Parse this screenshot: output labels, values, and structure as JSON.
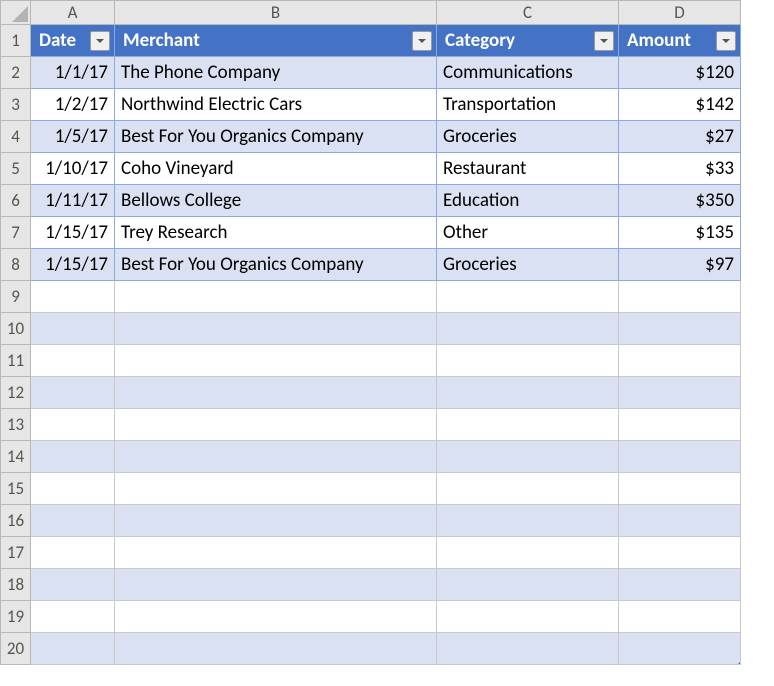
{
  "columns": [
    "A",
    "B",
    "C",
    "D"
  ],
  "row_count": 20,
  "table": {
    "headers": [
      {
        "label": "Date"
      },
      {
        "label": "Merchant"
      },
      {
        "label": "Category"
      },
      {
        "label": "Amount"
      }
    ],
    "rows": [
      {
        "date": "1/1/17",
        "merchant": "The Phone Company",
        "category": "Communications",
        "amount": "$120"
      },
      {
        "date": "1/2/17",
        "merchant": "Northwind Electric Cars",
        "category": "Transportation",
        "amount": "$142"
      },
      {
        "date": "1/5/17",
        "merchant": "Best For You Organics Company",
        "category": "Groceries",
        "amount": "$27"
      },
      {
        "date": "1/10/17",
        "merchant": "Coho Vineyard",
        "category": "Restaurant",
        "amount": "$33"
      },
      {
        "date": "1/11/17",
        "merchant": "Bellows College",
        "category": "Education",
        "amount": "$350"
      },
      {
        "date": "1/15/17",
        "merchant": "Trey Research",
        "category": "Other",
        "amount": "$135"
      },
      {
        "date": "1/15/17",
        "merchant": "Best For You Organics Company",
        "category": "Groceries",
        "amount": "$97"
      }
    ]
  },
  "chart_data": {
    "type": "table",
    "columns": [
      "Date",
      "Merchant",
      "Category",
      "Amount"
    ],
    "rows": [
      [
        "1/1/17",
        "The Phone Company",
        "Communications",
        120
      ],
      [
        "1/2/17",
        "Northwind Electric Cars",
        "Transportation",
        142
      ],
      [
        "1/5/17",
        "Best For You Organics Company",
        "Groceries",
        27
      ],
      [
        "1/10/17",
        "Coho Vineyard",
        "Restaurant",
        33
      ],
      [
        "1/11/17",
        "Bellows College",
        "Education",
        350
      ],
      [
        "1/15/17",
        "Trey Research",
        "Other",
        135
      ],
      [
        "1/15/17",
        "Best For You Organics Company",
        "Groceries",
        97
      ]
    ]
  }
}
